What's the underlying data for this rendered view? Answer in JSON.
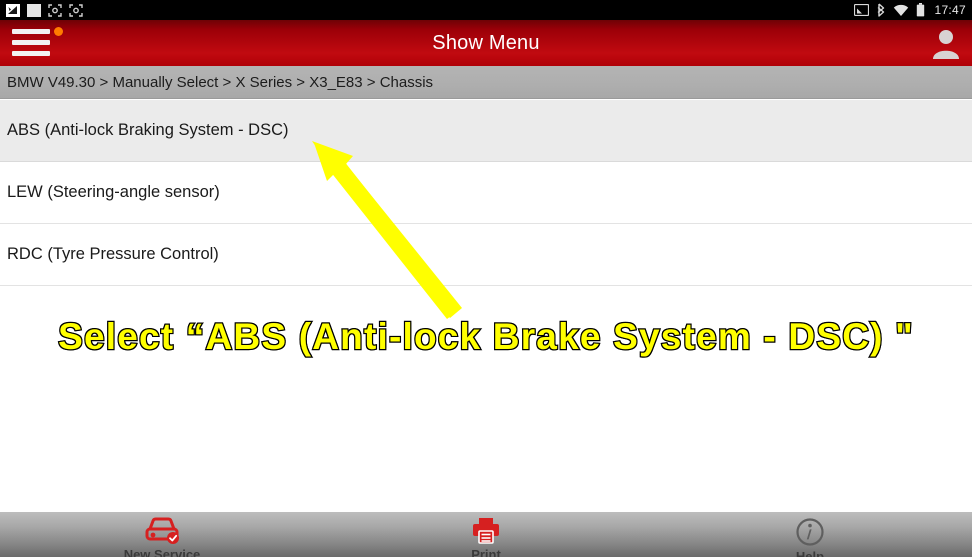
{
  "statusbar": {
    "left_icons": [
      "signal-icon",
      "sim-card-icon",
      "screenshot-icon",
      "screenshot-icon-2"
    ],
    "right_icons": [
      "cast-icon",
      "bluetooth-icon",
      "wifi-icon",
      "battery-icon"
    ],
    "clock": "17:47"
  },
  "appbar": {
    "menu_icon": "hamburger-menu-icon",
    "badge": "notification-dot",
    "title": "Show Menu",
    "user_icon": "user-account-icon"
  },
  "breadcrumb": {
    "text": "BMW V49.30 > Manually Select > X Series > X3_E83 > Chassis"
  },
  "list": {
    "items": [
      {
        "label": "ABS (Anti-lock Braking System - DSC)",
        "selected": true
      },
      {
        "label": "LEW (Steering-angle sensor)",
        "selected": false
      },
      {
        "label": "RDC (Tyre Pressure Control)",
        "selected": false
      }
    ]
  },
  "annotation": {
    "text": "Select “ABS (Anti-lock Brake System - DSC) \"",
    "arrow_color": "#ffff00",
    "text_color": "#ffff00",
    "outline_color": "#000000"
  },
  "toolbar": {
    "buttons": [
      {
        "label": "New Service",
        "icon": "car-check-icon"
      },
      {
        "label": "Print",
        "icon": "printer-icon"
      },
      {
        "label": "Help",
        "icon": "info-icon"
      }
    ]
  },
  "colors": {
    "header_red": "#b00007",
    "accent_orange": "#ff7b00",
    "breadcrumb_gray": "#aeaeae",
    "selected_row": "#ebebeb"
  }
}
